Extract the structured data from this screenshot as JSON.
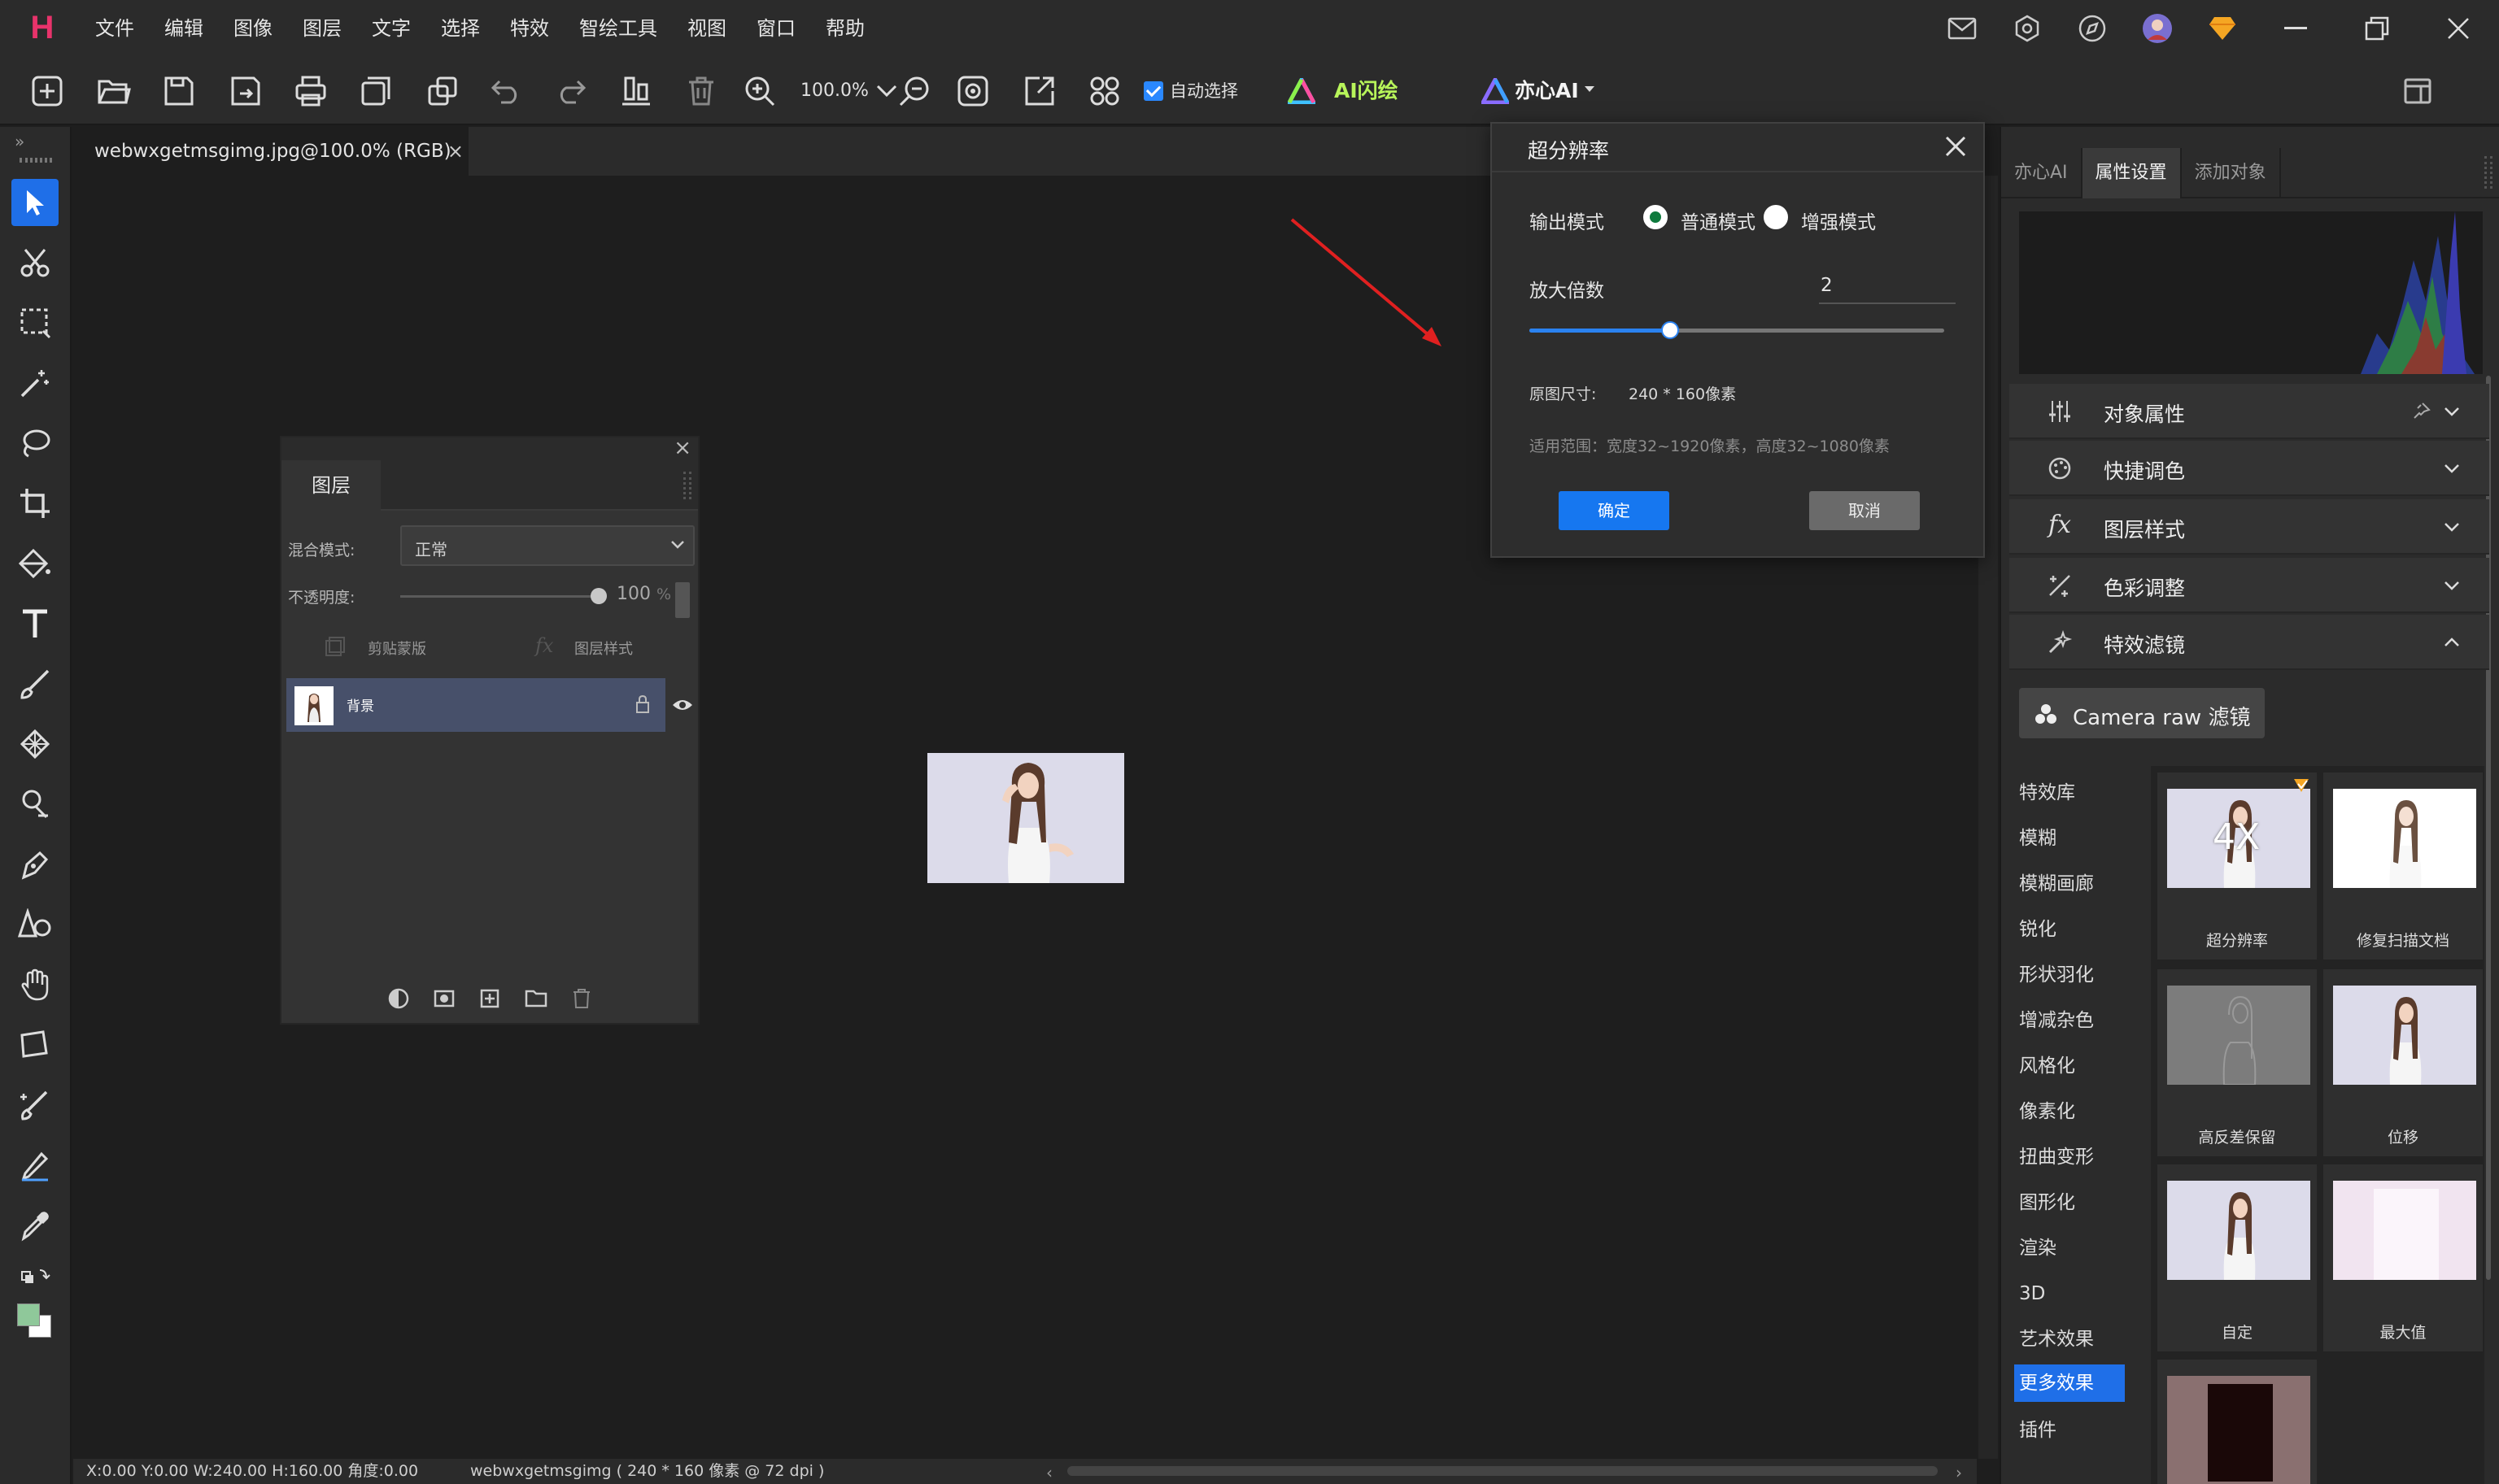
{
  "menu": {
    "items": [
      "文件",
      "编辑",
      "图像",
      "图层",
      "文字",
      "选择",
      "特效",
      "智绘工具",
      "视图",
      "窗口",
      "帮助"
    ]
  },
  "toolbar": {
    "zoom_level": "100.0%",
    "auto_select_label": "自动选择",
    "auto_select_checked": true,
    "ai_flash_label": "AI闪绘",
    "yixin_ai_label": "亦心AI"
  },
  "document": {
    "tab_title": "webwxgetmsgimg.jpg@100.0% (RGB)",
    "tab_close": "×"
  },
  "status": {
    "coords": "X:0.00 Y:0.00 W:240.00 H:160.00 角度:0.00",
    "file_info": "webwxgetmsgimg ( 240 * 160 像素 @ 72 dpi )"
  },
  "layer_panel": {
    "tab": "图层",
    "blend_mode_label": "混合模式:",
    "blend_mode_value": "正常",
    "opacity_label": "不透明度:",
    "opacity_value": "100",
    "opacity_unit": "%",
    "clip_mask_label": "剪贴蒙版",
    "layer_style_label": "图层样式",
    "layer_name": "背景"
  },
  "super_resolution_dialog": {
    "title": "超分辨率",
    "output_mode_label": "输出模式",
    "mode_normal": "普通模式",
    "mode_enhanced": "增强模式",
    "selected_mode": "普通模式",
    "scale_label": "放大倍数",
    "scale_value": "2",
    "original_size_label": "原图尺寸:",
    "original_size_value": "240 * 160像素",
    "range_note": "适用范围：宽度32~1920像素，高度32~1080像素",
    "ok_label": "确定",
    "cancel_label": "取消"
  },
  "right_panel": {
    "tabs": [
      "亦心AI",
      "属性设置",
      "添加对象"
    ],
    "active_tab": "属性设置",
    "sections": [
      {
        "label": "对象属性",
        "icon": "sliders-icon",
        "expanded": false
      },
      {
        "label": "快捷调色",
        "icon": "palette-icon",
        "expanded": false
      },
      {
        "label": "图层样式",
        "icon": "fx-icon",
        "expanded": false
      },
      {
        "label": "色彩调整",
        "icon": "color-adjust-icon",
        "expanded": false
      },
      {
        "label": "特效滤镜",
        "icon": "magic-wand-icon",
        "expanded": true
      }
    ],
    "camera_raw_label": "Camera raw 滤镜",
    "fx_categories": [
      "特效库",
      "模糊",
      "模糊画廊",
      "锐化",
      "形状羽化",
      "增减杂色",
      "风格化",
      "像素化",
      "扭曲变形",
      "图形化",
      "渲染",
      "3D",
      "艺术效果",
      "更多效果",
      "插件"
    ],
    "active_category": "更多效果",
    "fx_items": [
      {
        "label": "超分辨率",
        "thumb_text": "4X"
      },
      {
        "label": "修复扫描文档",
        "thumb_text": ""
      },
      {
        "label": "高反差保留",
        "thumb_text": ""
      },
      {
        "label": "位移",
        "thumb_text": ""
      },
      {
        "label": "自定",
        "thumb_text": ""
      },
      {
        "label": "最大值",
        "thumb_text": ""
      }
    ]
  },
  "colors": {
    "accent": "#1f6fe8",
    "radio_selected": "#0e7a3d",
    "arrow": "#e02020",
    "logo": "#e8336b"
  }
}
